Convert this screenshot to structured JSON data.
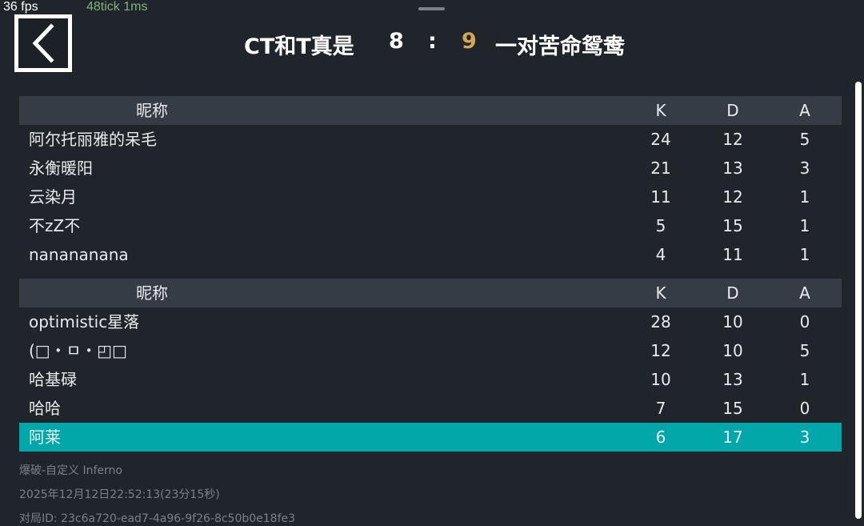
{
  "debug": {
    "fps": "36 fps",
    "tick": "48tick 1ms"
  },
  "header": {
    "team_ct": "CT和T真是",
    "score_ct": "8",
    "separator": ":",
    "score_t": "9",
    "team_t": "一对苦命鸳鸯",
    "score_t_color": "#d4a653"
  },
  "columns": {
    "name": "昵称",
    "k": "K",
    "d": "D",
    "a": "A"
  },
  "team1_rows": [
    {
      "name": "阿尔托丽雅的呆毛",
      "k": "24",
      "d": "12",
      "a": "5"
    },
    {
      "name": "永衡暖阳",
      "k": "21",
      "d": "13",
      "a": "3"
    },
    {
      "name": "云染月",
      "k": "11",
      "d": "12",
      "a": "1"
    },
    {
      "name": "不zZ不",
      "k": "5",
      "d": "15",
      "a": "1"
    },
    {
      "name": "nanananana",
      "k": "4",
      "d": "11",
      "a": "1"
    }
  ],
  "team2_rows": [
    {
      "name": "optimistic星落",
      "k": "28",
      "d": "10",
      "a": "0"
    },
    {
      "name": "(□・ㅁ・◰□",
      "k": "12",
      "d": "10",
      "a": "5"
    },
    {
      "name": "哈基碌",
      "k": "10",
      "d": "13",
      "a": "1"
    },
    {
      "name": "哈哈",
      "k": "7",
      "d": "15",
      "a": "0"
    },
    {
      "name": "阿莱",
      "k": "6",
      "d": "17",
      "a": "3",
      "highlighted": true
    }
  ],
  "footer": {
    "mode": "爆破-自定义 Inferno",
    "time": "2025年12月12日22:52:13(23分15秒)",
    "match_id": "对局ID: 23c6a720-ead7-4a96-9f26-8c50b0e18fe3"
  },
  "colors": {
    "highlight_row": "#02a8a9",
    "background": "#20252c",
    "header_row": "#363c45"
  },
  "icons": {
    "back": "chevron-left-icon"
  }
}
